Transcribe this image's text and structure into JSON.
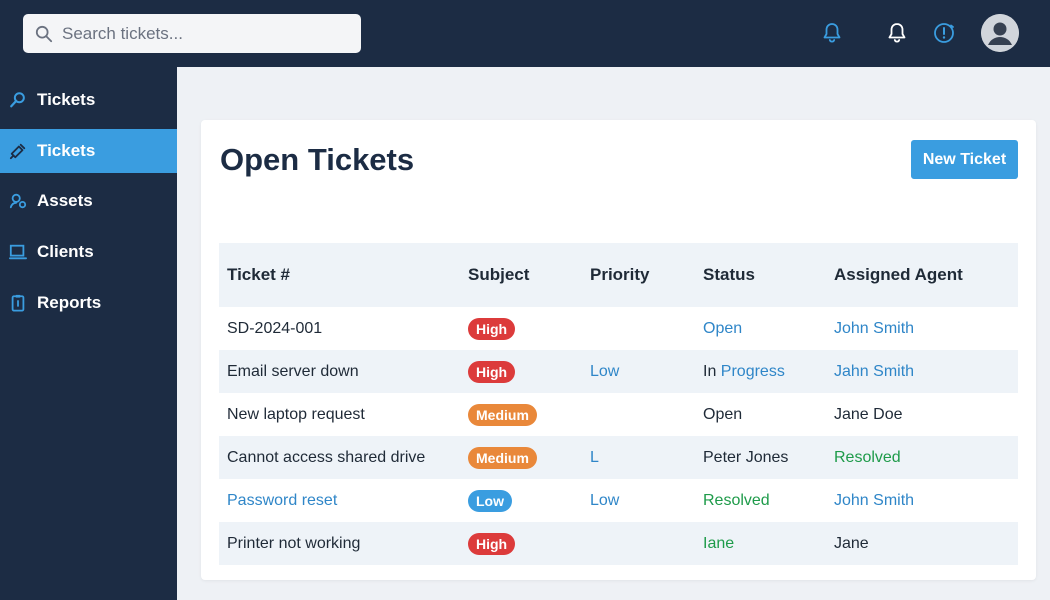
{
  "search": {
    "placeholder": "Search tickets..."
  },
  "header_icons": [
    {
      "name": "bell-icon",
      "color": "#3a9de0"
    },
    {
      "name": "bell-icon",
      "color": "#ffffff"
    },
    {
      "name": "alert-clock-icon",
      "color": "#3a9de0"
    }
  ],
  "sidebar": {
    "items": [
      {
        "label": "Tickets",
        "icon": "search-icon",
        "active": false
      },
      {
        "label": "Tickets",
        "icon": "ticket-icon",
        "active": true
      },
      {
        "label": "Assets",
        "icon": "assets-icon",
        "active": false
      },
      {
        "label": "Clients",
        "icon": "monitor-icon",
        "active": false
      },
      {
        "label": "Reports",
        "icon": "report-icon",
        "active": false
      }
    ]
  },
  "main": {
    "title": "Open Tickets",
    "new_button": "New Ticket",
    "columns": [
      "Ticket #",
      "Subject",
      "Priority",
      "Status",
      "Assigned Agent"
    ],
    "rows": [
      {
        "cells": [
          {
            "text": "SD-2024-001",
            "color": "#1f2a37"
          },
          {
            "text": "High",
            "badge": "#dc3b3b"
          },
          {
            "text": "",
            "color": "#1f2a37"
          },
          {
            "text": "Open",
            "color": "#2f86c8"
          },
          {
            "text": "John Smith",
            "color": "#2f86c8"
          }
        ]
      },
      {
        "cells": [
          {
            "text": "Email server down",
            "color": "#1f2a37"
          },
          {
            "text": "High",
            "badge": "#dc3b3b"
          },
          {
            "text": "Low",
            "color": "#2f86c8"
          },
          {
            "parts": [
              {
                "text": "In ",
                "color": "#1f2a37"
              },
              {
                "text": "Progress",
                "color": "#2f86c8"
              }
            ]
          },
          {
            "text": "Jahn Smith",
            "color": "#2f86c8"
          }
        ]
      },
      {
        "cells": [
          {
            "text": "New laptop request",
            "color": "#1f2a37"
          },
          {
            "text": "Medium",
            "badge": "#e9883a"
          },
          {
            "text": "",
            "color": "#1f2a37"
          },
          {
            "text": "Open",
            "color": "#1f2a37"
          },
          {
            "text": "Jane Doe",
            "color": "#1f2a37"
          }
        ]
      },
      {
        "cells": [
          {
            "text": "Cannot access shared drive",
            "color": "#1f2a37"
          },
          {
            "text": "Medium",
            "badge": "#e9883a"
          },
          {
            "text": "L",
            "color": "#2f86c8"
          },
          {
            "text": "Peter Jones",
            "color": "#1f2a37"
          },
          {
            "text": "Resolved",
            "color": "#1e9b4a"
          }
        ]
      },
      {
        "cells": [
          {
            "text": "Password reset",
            "color": "#2f86c8"
          },
          {
            "text": "Low",
            "badge": "#3a9de0"
          },
          {
            "text": "Low",
            "color": "#2f86c8"
          },
          {
            "text": "Resolved",
            "color": "#1e9b4a"
          },
          {
            "text": "John Smith",
            "color": "#2f86c8"
          }
        ]
      },
      {
        "cells": [
          {
            "text": "Printer not working",
            "color": "#1f2a37"
          },
          {
            "text": "High",
            "badge": "#dc3b3b"
          },
          {
            "text": "",
            "color": "#1f2a37"
          },
          {
            "text": "Iane",
            "color": "#1e9b4a"
          },
          {
            "text": "Jane",
            "color": "#1f2a37"
          }
        ]
      }
    ]
  }
}
